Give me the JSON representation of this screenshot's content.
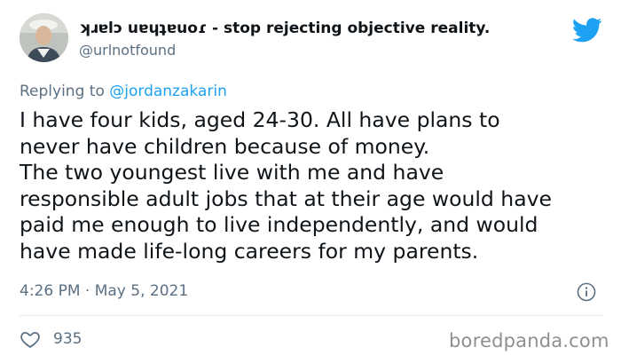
{
  "tweet": {
    "display_name": "ʞɹɐlɔ uɐɥʇɐuoɾ - stop rejecting objective reality.",
    "handle": "@urlnotfound",
    "replying_prefix": "Replying to ",
    "replying_to": "@jordanzakarin",
    "lines": [
      "I have four kids, aged 24-30. All have plans to",
      "never have children because of money.",
      "The two youngest live with me and have",
      "responsible adult jobs that at their age would have",
      "paid me enough to live independently, and would",
      "have made life-long careers for my parents."
    ],
    "timestamp": "4:26 PM · May 5, 2021",
    "like_count": "935"
  },
  "icons": {
    "platform": "twitter-bird-icon",
    "info": "info-icon",
    "like": "heart-icon"
  },
  "colors": {
    "accent": "#1da1f2",
    "secondary_text": "#5b7083",
    "primary_text": "#0f1419"
  },
  "watermark": "boredpanda.com"
}
